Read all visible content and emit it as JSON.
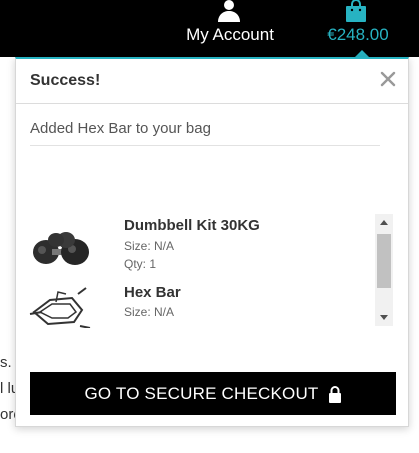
{
  "header": {
    "account_label": "My Account",
    "cart_total": "€248.00",
    "icons": {
      "account": "user-icon",
      "cart": "shopping-bag-icon"
    }
  },
  "modal": {
    "title": "Success!",
    "message": "Added Hex Bar to your bag",
    "close_icon": "close-icon",
    "items": [
      {
        "name": "Dumbbell Kit 30KG",
        "size": "Size: N/A",
        "qty": "Qty: 1",
        "icon": "dumbbell-kit-image"
      },
      {
        "name": "Hex Bar",
        "size": "Size: N/A",
        "icon": "hex-bar-image"
      }
    ],
    "checkout_label": "GO TO SECURE CHECKOUT",
    "checkout_icon": "lock-icon"
  },
  "background_text": [
    "s. .",
    "l lu",
    "ore"
  ],
  "colors": {
    "header_bg": "#000000",
    "accent": "#27b3c2",
    "button_bg": "#000000"
  }
}
